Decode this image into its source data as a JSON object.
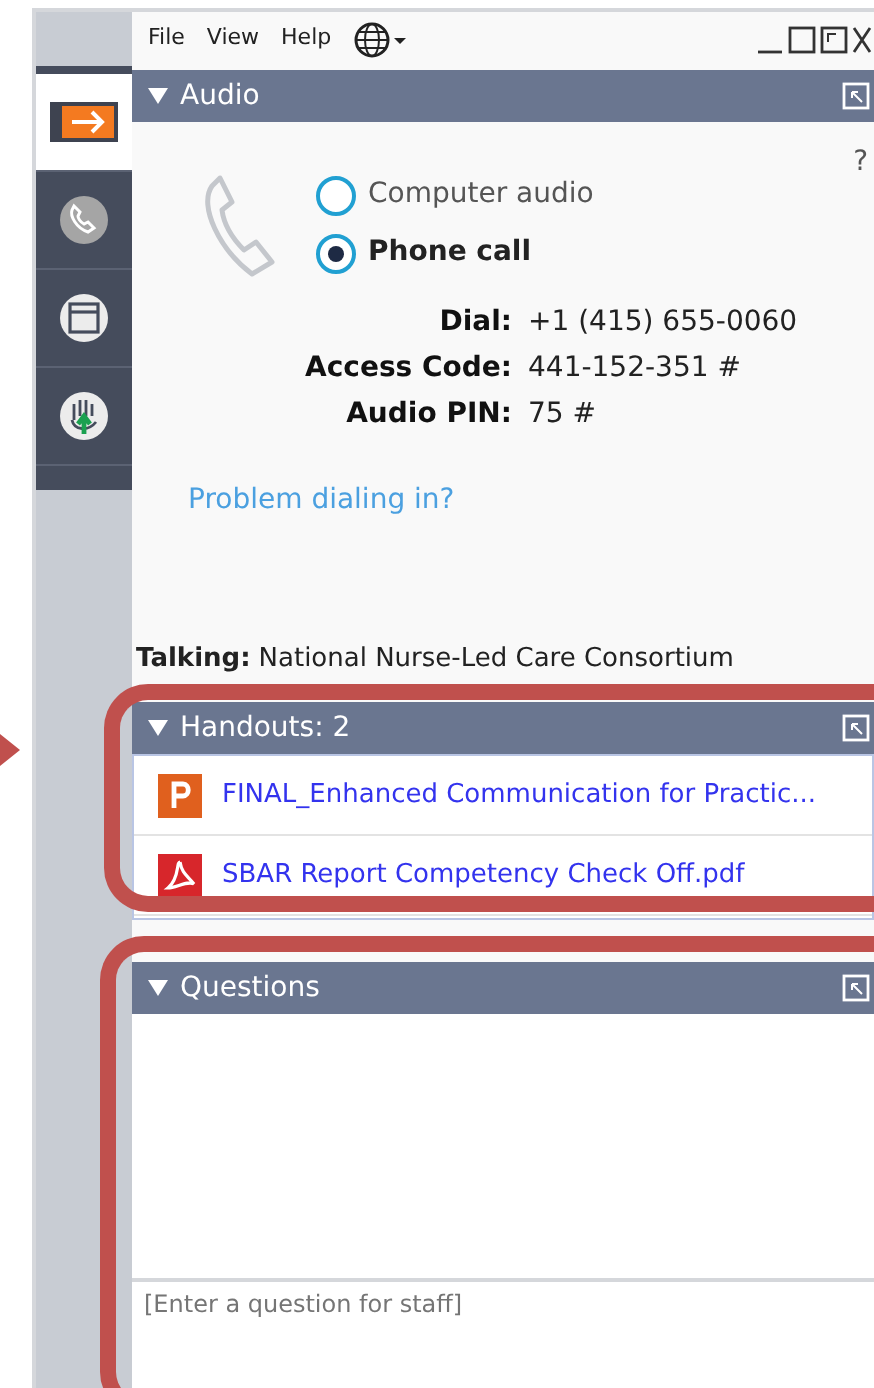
{
  "menu": [
    "File",
    "View",
    "Help"
  ],
  "sidebar": [
    {
      "kind": "arrow",
      "selected": true
    },
    {
      "kind": "phone",
      "selected": false
    },
    {
      "kind": "window",
      "selected": false
    },
    {
      "kind": "hand",
      "selected": false
    }
  ],
  "audio": {
    "title": "Audio",
    "help": "?",
    "options": [
      {
        "label": "Computer audio",
        "selected": false
      },
      {
        "label": "Phone call",
        "selected": true
      }
    ],
    "details": [
      {
        "label": "Dial:",
        "value": "+1 (415) 655-0060"
      },
      {
        "label": "Access Code:",
        "value": "441-152-351 #"
      },
      {
        "label": "Audio PIN:",
        "value": "75 #"
      }
    ],
    "link": "Problem dialing in?",
    "talking_label": "Talking:",
    "talking": "National Nurse-Led Care Consortium"
  },
  "handouts": {
    "title": "Handouts: 2",
    "files": [
      {
        "kind": "ppt",
        "name": "FINAL_Enhanced Communication for Practic..."
      },
      {
        "kind": "pdf",
        "name": "SBAR Report Competency Check Off.pdf"
      }
    ]
  },
  "questions": {
    "title": "Questions",
    "placeholder": "[Enter a question for staff]"
  }
}
